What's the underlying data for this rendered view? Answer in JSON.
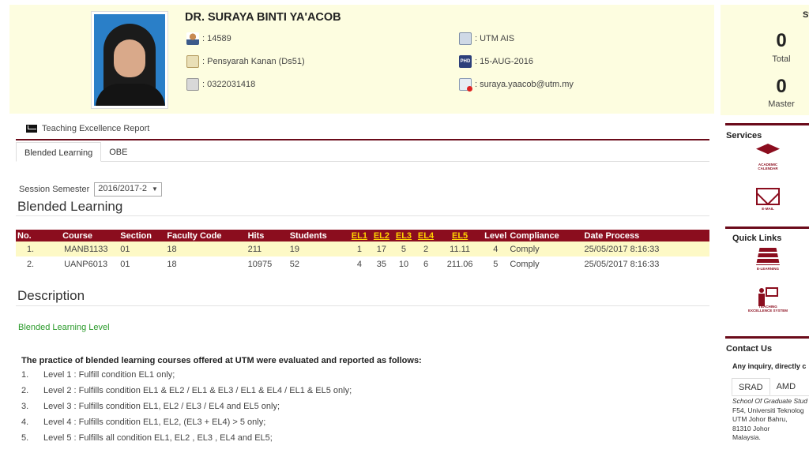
{
  "profile": {
    "name": "DR. SURAYA BINTI YA'ACOB",
    "staff_no": ": 14589",
    "position": ": Pensyarah Kanan (Ds51)",
    "phone": ": 0322031418",
    "faculty": ": UTM AIS",
    "phd_date": ": 15-AUG-2016",
    "email": ": suraya.yaacob@utm.my"
  },
  "report_link": "Teaching Excellence Report",
  "tabs": [
    "Blended Learning",
    "OBE"
  ],
  "session": {
    "label": "Session Semester",
    "value": "2016/2017-2",
    "arrow": "▼"
  },
  "section_title": "Blended Learning",
  "table": {
    "headers": [
      "No.",
      "Course",
      "Section",
      "Faculty Code",
      "Hits",
      "Students",
      "EL1",
      "EL2",
      "EL3",
      "EL4",
      "EL5",
      "Level",
      "Compliance",
      "Date Process"
    ],
    "rows": [
      [
        "1.",
        "MANB1133",
        "01",
        "18",
        "211",
        "19",
        "1",
        "17",
        "5",
        "2",
        "11.11",
        "4",
        "Comply",
        "25/05/2017 8:16:33"
      ],
      [
        "2.",
        "UANP6013",
        "01",
        "18",
        "10975",
        "52",
        "4",
        "35",
        "10",
        "6",
        "211.06",
        "5",
        "Comply",
        "25/05/2017 8:16:33"
      ]
    ]
  },
  "description": {
    "title": "Description",
    "subtitle": "Blended Learning Level",
    "intro": "The practice of blended learning courses offered at UTM were evaluated and reported as follows:",
    "levels": [
      {
        "n": "1.",
        "text": "Level 1 : Fulfill condition EL1 only;"
      },
      {
        "n": "2.",
        "text": "Level 2 : Fulfills condition EL1 & EL2 / EL1 & EL3 / EL1 & EL4 / EL1 & EL5 only;"
      },
      {
        "n": "3.",
        "text": "Level 3 : Fulfills condition EL1, EL2 / EL3 / EL4 and EL5 only;"
      },
      {
        "n": "4.",
        "text": "Level 4 : Fulfills condition EL1, EL2, (EL3 + EL4) > 5 only;"
      },
      {
        "n": "5.",
        "text": "Level 5 : Fulfills all condition EL1, EL2 , EL3 , EL4 and EL5;"
      }
    ]
  },
  "sidebar": {
    "stats_head": "St",
    "total_value": "0",
    "total_label": "Total",
    "master_value": "0",
    "master_label": "Master",
    "services_title": "Services",
    "services": [
      "ACADEMIC CALENDAR",
      "E-MAIL"
    ],
    "quick_links_title": "Quick Links",
    "quick_links": [
      "E-LEARNING",
      "TEACHING EXCELLENCE SYSTEM"
    ],
    "contact_title": "Contact Us",
    "inquiry": "Any inquiry, directly c",
    "contact_tabs": [
      "SRAD",
      "AMD"
    ],
    "address": [
      "School Of Graduate Stud",
      "F54, Universiti Teknolog",
      "UTM Johor Bahru,",
      "81310 Johor",
      "Malaysia."
    ]
  },
  "colors": {
    "header_bg": "#fdfde0",
    "maroon": "#8b0d1e",
    "gold_link": "#ffd400",
    "green_text": "#2a9a2a"
  }
}
